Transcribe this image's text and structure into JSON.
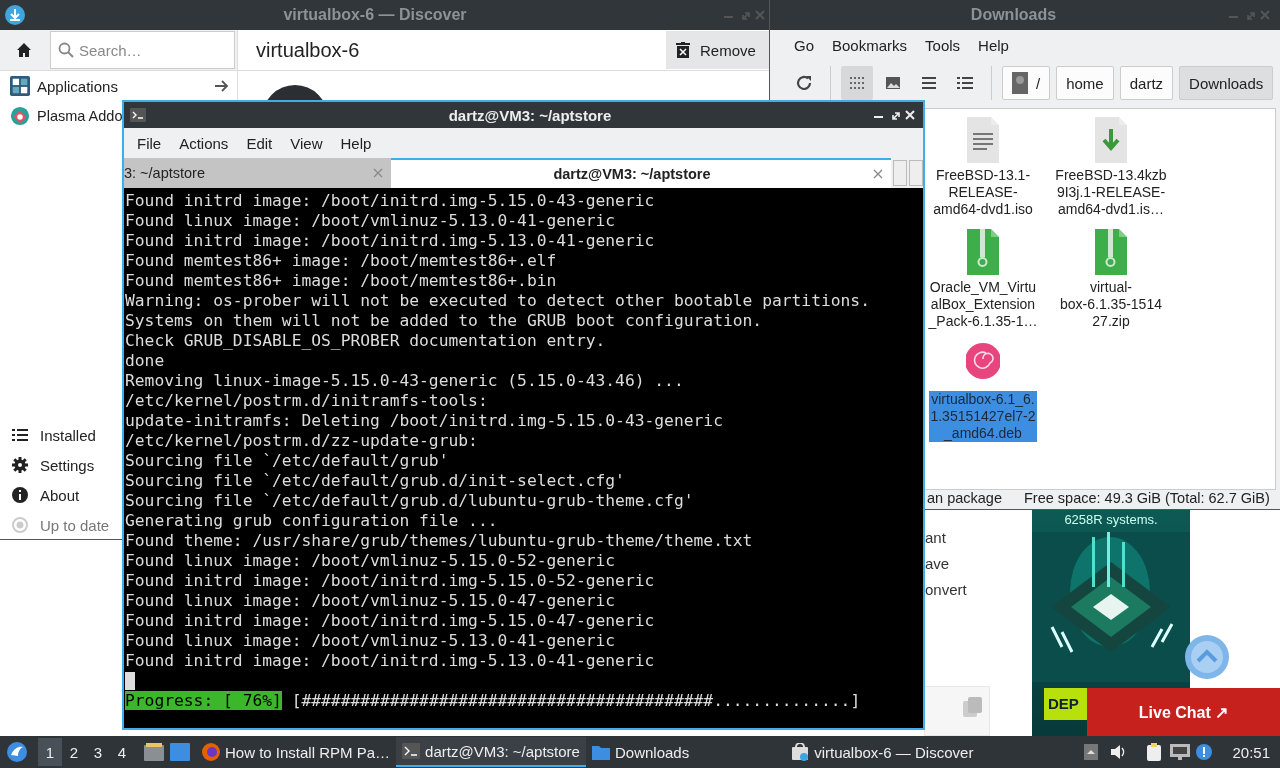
{
  "browser": {
    "texts": [
      "ant",
      "ave",
      "onvert"
    ],
    "ad": {
      "caption": "6258R systems.",
      "button": "DEP"
    },
    "live_chat": "Live Chat ↗"
  },
  "discover": {
    "title": "virtualbox-6 — Discover",
    "search": {
      "placeholder": "Search…"
    },
    "nav": [
      {
        "label": "Applications"
      },
      {
        "label": "Plasma Addo"
      }
    ],
    "page_title": "virtualbox-6",
    "remove_button": "Remove",
    "bottom_nav": [
      {
        "label": "Installed",
        "disabled": false
      },
      {
        "label": "Settings",
        "disabled": false
      },
      {
        "label": "About",
        "disabled": false
      },
      {
        "label": "Up to date",
        "disabled": true
      }
    ]
  },
  "files": {
    "title": "Downloads",
    "menu": [
      "Go",
      "Bookmarks",
      "Tools",
      "Help"
    ],
    "view_modes": [
      {
        "selected": true
      },
      {
        "selected": false
      },
      {
        "selected": false
      },
      {
        "selected": false
      }
    ],
    "path": [
      {
        "label": "/",
        "kind": "root",
        "selected": false
      },
      {
        "label": "home",
        "kind": "folder",
        "selected": false
      },
      {
        "label": "dartz",
        "kind": "folder",
        "selected": false
      },
      {
        "label": "Downloads",
        "kind": "folder",
        "selected": true
      }
    ],
    "items": [
      {
        "name": "FreeBSD-13.1-\nRELEASE-\namd64-dvd1.iso",
        "kind": "document",
        "selected": false
      },
      {
        "name": "FreeBSD-13.4kzb\n9I3j.1-RELEASE-\namd64-dvd1.is…",
        "kind": "download",
        "selected": false
      },
      {
        "name": "Oracle_VM_Virtu\nalBox_Extension\n_Pack-6.1.35-1…",
        "kind": "archive",
        "selected": false
      },
      {
        "name": "virtual-\nbox-6.1.35-1514\n27.zip",
        "kind": "archive",
        "selected": false
      },
      {
        "name": "virtualbox-6.1_6.\n1.35151427el7-2\n_amd64.deb",
        "kind": "package",
        "selected": true
      }
    ],
    "status": "an package",
    "free_space": "Free space: 49.3 GiB (Total: 62.7 GiB)"
  },
  "terminal": {
    "title": "dartz@VM3: ~/aptstore",
    "menu": [
      "File",
      "Actions",
      "Edit",
      "View",
      "Help"
    ],
    "tabs": [
      {
        "label": "3: ~/aptstore",
        "selected": false
      },
      {
        "label": "dartz@VM3: ~/aptstore",
        "selected": true
      }
    ],
    "lines": [
      "Found initrd image: /boot/initrd.img-5.15.0-43-generic",
      "Found linux image: /boot/vmlinuz-5.13.0-41-generic",
      "Found initrd image: /boot/initrd.img-5.13.0-41-generic",
      "Found memtest86+ image: /boot/memtest86+.elf",
      "Found memtest86+ image: /boot/memtest86+.bin",
      "Warning: os-prober will not be executed to detect other bootable partitions.",
      "Systems on them will not be added to the GRUB boot configuration.",
      "Check GRUB_DISABLE_OS_PROBER documentation entry.",
      "done",
      "Removing linux-image-5.15.0-43-generic (5.15.0-43.46) ...",
      "/etc/kernel/postrm.d/initramfs-tools:",
      "update-initramfs: Deleting /boot/initrd.img-5.15.0-43-generic",
      "/etc/kernel/postrm.d/zz-update-grub:",
      "Sourcing file `/etc/default/grub'",
      "Sourcing file `/etc/default/grub.d/init-select.cfg'",
      "Sourcing file `/etc/default/grub.d/lubuntu-grub-theme.cfg'",
      "Generating grub configuration file ...",
      "Found theme: /usr/share/grub/themes/lubuntu-grub-theme/theme.txt",
      "Found linux image: /boot/vmlinuz-5.15.0-52-generic",
      "Found initrd image: /boot/initrd.img-5.15.0-52-generic",
      "Found linux image: /boot/vmlinuz-5.15.0-47-generic",
      "Found initrd image: /boot/initrd.img-5.15.0-47-generic",
      "Found linux image: /boot/vmlinuz-5.13.0-41-generic",
      "Found initrd image: /boot/initrd.img-5.13.0-41-generic"
    ],
    "progress_label": "Progress: [ 76%]",
    "progress_bar": "[##########################################..............]"
  },
  "taskbar": {
    "workspaces": [
      {
        "label": "1",
        "selected": true
      },
      {
        "label": "2",
        "selected": false
      },
      {
        "label": "3",
        "selected": false
      },
      {
        "label": "4",
        "selected": false
      }
    ],
    "tasks": [
      {
        "label": "How to Install RPM Pa…",
        "kind": "browser",
        "selected": false
      },
      {
        "label": "dartz@VM3: ~/aptstore",
        "kind": "terminal",
        "selected": true
      },
      {
        "label": "Downloads",
        "kind": "folder",
        "selected": false
      },
      {
        "label": "virtualbox-6 — Discover",
        "kind": "store",
        "selected": false
      }
    ],
    "clock": "20:51"
  }
}
